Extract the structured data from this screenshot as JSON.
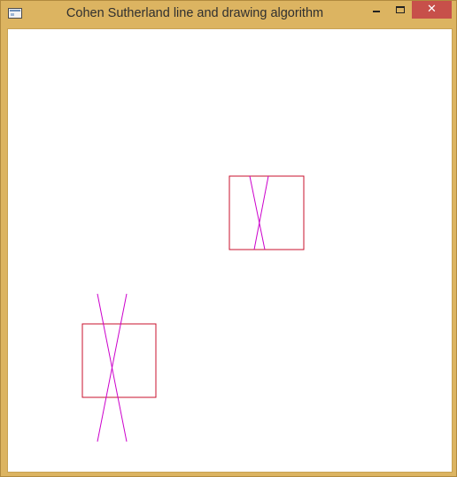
{
  "window": {
    "title": "Cohen Sutherland line and drawing algorithm",
    "controls": {
      "minimize_icon": "minimize-icon",
      "maximize_icon": "maximize-icon",
      "close_glyph": "✕"
    }
  },
  "colors": {
    "frame": "#dcb461",
    "clip_rect": "#c8102e",
    "line": "#cc00cc",
    "background": "#ffffff",
    "close_button": "#c7504a"
  }
}
